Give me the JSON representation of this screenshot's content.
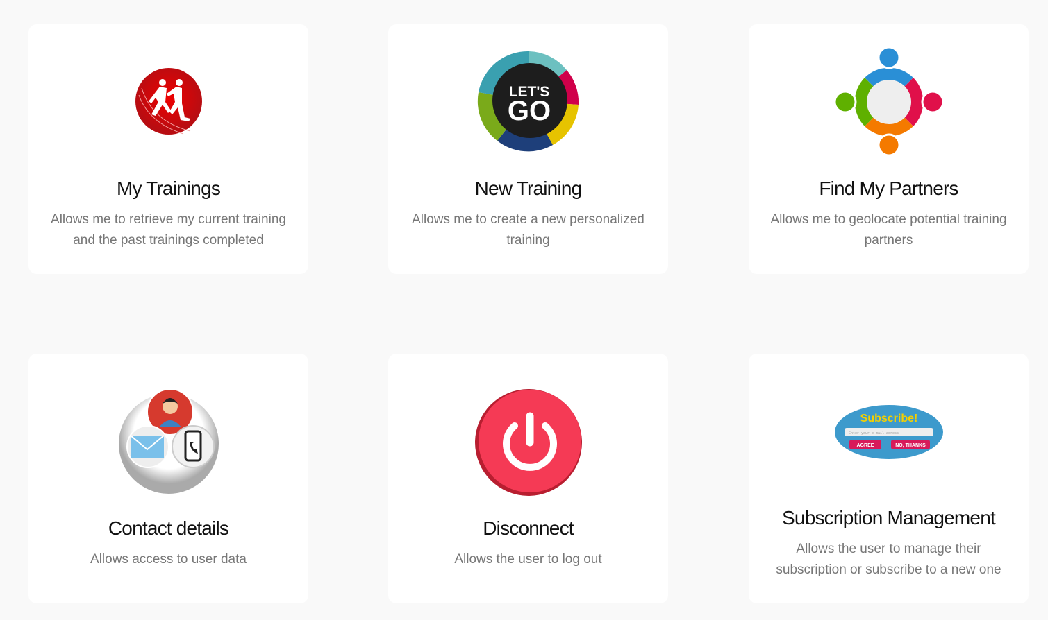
{
  "cards": [
    {
      "title": "My Trainings",
      "description": "Allows me to retrieve my current training and the past trainings completed",
      "icon": "runners-icon"
    },
    {
      "title": "New Training",
      "description": "Allows me to create a new personalized training",
      "icon": "lets-go-icon",
      "icon_text": [
        "LET'S",
        "GO"
      ]
    },
    {
      "title": "Find My Partners",
      "description": "Allows me to geolocate potential training partners",
      "icon": "partners-icon"
    },
    {
      "title": "Contact details",
      "description": "Allows access to user data",
      "icon": "contact-icon"
    },
    {
      "title": "Disconnect",
      "description": "Allows the user to log out",
      "icon": "power-icon"
    },
    {
      "title": "Subscription Management",
      "description": "Allows the user to manage their subscription or subscribe to a new one",
      "icon": "subscribe-icon",
      "icon_text": [
        "Subscribe!",
        "Enter your e-mail adress",
        "AGREE",
        "NO, THANKS"
      ]
    }
  ],
  "colors": {
    "background": "#f9f9f9",
    "card": "#ffffff",
    "title": "#111111",
    "description": "#777777"
  }
}
